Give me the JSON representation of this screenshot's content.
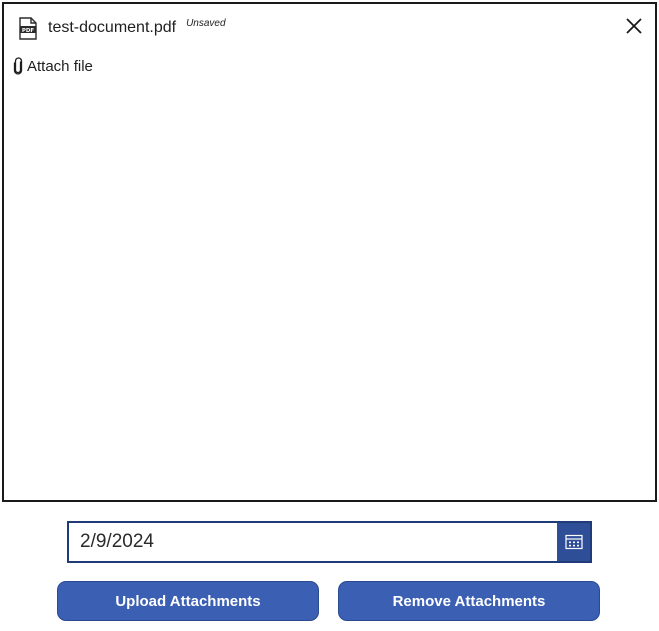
{
  "attachments": {
    "file": {
      "name": "test-document.pdf",
      "status": "Unsaved",
      "icon": "pdf-file-icon"
    },
    "close_icon": "close-icon",
    "attach_label": "Attach file",
    "attach_icon": "paperclip-icon"
  },
  "date_picker": {
    "value": "2/9/2024",
    "icon": "calendar-icon"
  },
  "buttons": {
    "upload_label": "Upload Attachments",
    "remove_label": "Remove Attachments"
  },
  "colors": {
    "button_fill": "#3a5fb3",
    "date_border": "#1f3b79",
    "calendar_button": "#2e4f98"
  }
}
